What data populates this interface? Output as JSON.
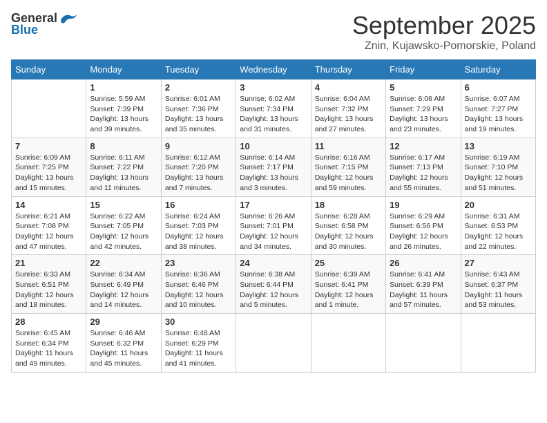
{
  "header": {
    "logo_general": "General",
    "logo_blue": "Blue",
    "month": "September 2025",
    "location": "Znin, Kujawsko-Pomorskie, Poland"
  },
  "weekdays": [
    "Sunday",
    "Monday",
    "Tuesday",
    "Wednesday",
    "Thursday",
    "Friday",
    "Saturday"
  ],
  "weeks": [
    [
      {
        "day": "",
        "sunrise": "",
        "sunset": "",
        "daylight": ""
      },
      {
        "day": "1",
        "sunrise": "Sunrise: 5:59 AM",
        "sunset": "Sunset: 7:39 PM",
        "daylight": "Daylight: 13 hours and 39 minutes."
      },
      {
        "day": "2",
        "sunrise": "Sunrise: 6:01 AM",
        "sunset": "Sunset: 7:36 PM",
        "daylight": "Daylight: 13 hours and 35 minutes."
      },
      {
        "day": "3",
        "sunrise": "Sunrise: 6:02 AM",
        "sunset": "Sunset: 7:34 PM",
        "daylight": "Daylight: 13 hours and 31 minutes."
      },
      {
        "day": "4",
        "sunrise": "Sunrise: 6:04 AM",
        "sunset": "Sunset: 7:32 PM",
        "daylight": "Daylight: 13 hours and 27 minutes."
      },
      {
        "day": "5",
        "sunrise": "Sunrise: 6:06 AM",
        "sunset": "Sunset: 7:29 PM",
        "daylight": "Daylight: 13 hours and 23 minutes."
      },
      {
        "day": "6",
        "sunrise": "Sunrise: 6:07 AM",
        "sunset": "Sunset: 7:27 PM",
        "daylight": "Daylight: 13 hours and 19 minutes."
      }
    ],
    [
      {
        "day": "7",
        "sunrise": "Sunrise: 6:09 AM",
        "sunset": "Sunset: 7:25 PM",
        "daylight": "Daylight: 13 hours and 15 minutes."
      },
      {
        "day": "8",
        "sunrise": "Sunrise: 6:11 AM",
        "sunset": "Sunset: 7:22 PM",
        "daylight": "Daylight: 13 hours and 11 minutes."
      },
      {
        "day": "9",
        "sunrise": "Sunrise: 6:12 AM",
        "sunset": "Sunset: 7:20 PM",
        "daylight": "Daylight: 13 hours and 7 minutes."
      },
      {
        "day": "10",
        "sunrise": "Sunrise: 6:14 AM",
        "sunset": "Sunset: 7:17 PM",
        "daylight": "Daylight: 13 hours and 3 minutes."
      },
      {
        "day": "11",
        "sunrise": "Sunrise: 6:16 AM",
        "sunset": "Sunset: 7:15 PM",
        "daylight": "Daylight: 12 hours and 59 minutes."
      },
      {
        "day": "12",
        "sunrise": "Sunrise: 6:17 AM",
        "sunset": "Sunset: 7:13 PM",
        "daylight": "Daylight: 12 hours and 55 minutes."
      },
      {
        "day": "13",
        "sunrise": "Sunrise: 6:19 AM",
        "sunset": "Sunset: 7:10 PM",
        "daylight": "Daylight: 12 hours and 51 minutes."
      }
    ],
    [
      {
        "day": "14",
        "sunrise": "Sunrise: 6:21 AM",
        "sunset": "Sunset: 7:08 PM",
        "daylight": "Daylight: 12 hours and 47 minutes."
      },
      {
        "day": "15",
        "sunrise": "Sunrise: 6:22 AM",
        "sunset": "Sunset: 7:05 PM",
        "daylight": "Daylight: 12 hours and 42 minutes."
      },
      {
        "day": "16",
        "sunrise": "Sunrise: 6:24 AM",
        "sunset": "Sunset: 7:03 PM",
        "daylight": "Daylight: 12 hours and 38 minutes."
      },
      {
        "day": "17",
        "sunrise": "Sunrise: 6:26 AM",
        "sunset": "Sunset: 7:01 PM",
        "daylight": "Daylight: 12 hours and 34 minutes."
      },
      {
        "day": "18",
        "sunrise": "Sunrise: 6:28 AM",
        "sunset": "Sunset: 6:58 PM",
        "daylight": "Daylight: 12 hours and 30 minutes."
      },
      {
        "day": "19",
        "sunrise": "Sunrise: 6:29 AM",
        "sunset": "Sunset: 6:56 PM",
        "daylight": "Daylight: 12 hours and 26 minutes."
      },
      {
        "day": "20",
        "sunrise": "Sunrise: 6:31 AM",
        "sunset": "Sunset: 6:53 PM",
        "daylight": "Daylight: 12 hours and 22 minutes."
      }
    ],
    [
      {
        "day": "21",
        "sunrise": "Sunrise: 6:33 AM",
        "sunset": "Sunset: 6:51 PM",
        "daylight": "Daylight: 12 hours and 18 minutes."
      },
      {
        "day": "22",
        "sunrise": "Sunrise: 6:34 AM",
        "sunset": "Sunset: 6:49 PM",
        "daylight": "Daylight: 12 hours and 14 minutes."
      },
      {
        "day": "23",
        "sunrise": "Sunrise: 6:36 AM",
        "sunset": "Sunset: 6:46 PM",
        "daylight": "Daylight: 12 hours and 10 minutes."
      },
      {
        "day": "24",
        "sunrise": "Sunrise: 6:38 AM",
        "sunset": "Sunset: 6:44 PM",
        "daylight": "Daylight: 12 hours and 5 minutes."
      },
      {
        "day": "25",
        "sunrise": "Sunrise: 6:39 AM",
        "sunset": "Sunset: 6:41 PM",
        "daylight": "Daylight: 12 hours and 1 minute."
      },
      {
        "day": "26",
        "sunrise": "Sunrise: 6:41 AM",
        "sunset": "Sunset: 6:39 PM",
        "daylight": "Daylight: 11 hours and 57 minutes."
      },
      {
        "day": "27",
        "sunrise": "Sunrise: 6:43 AM",
        "sunset": "Sunset: 6:37 PM",
        "daylight": "Daylight: 11 hours and 53 minutes."
      }
    ],
    [
      {
        "day": "28",
        "sunrise": "Sunrise: 6:45 AM",
        "sunset": "Sunset: 6:34 PM",
        "daylight": "Daylight: 11 hours and 49 minutes."
      },
      {
        "day": "29",
        "sunrise": "Sunrise: 6:46 AM",
        "sunset": "Sunset: 6:32 PM",
        "daylight": "Daylight: 11 hours and 45 minutes."
      },
      {
        "day": "30",
        "sunrise": "Sunrise: 6:48 AM",
        "sunset": "Sunset: 6:29 PM",
        "daylight": "Daylight: 11 hours and 41 minutes."
      },
      {
        "day": "",
        "sunrise": "",
        "sunset": "",
        "daylight": ""
      },
      {
        "day": "",
        "sunrise": "",
        "sunset": "",
        "daylight": ""
      },
      {
        "day": "",
        "sunrise": "",
        "sunset": "",
        "daylight": ""
      },
      {
        "day": "",
        "sunrise": "",
        "sunset": "",
        "daylight": ""
      }
    ]
  ]
}
